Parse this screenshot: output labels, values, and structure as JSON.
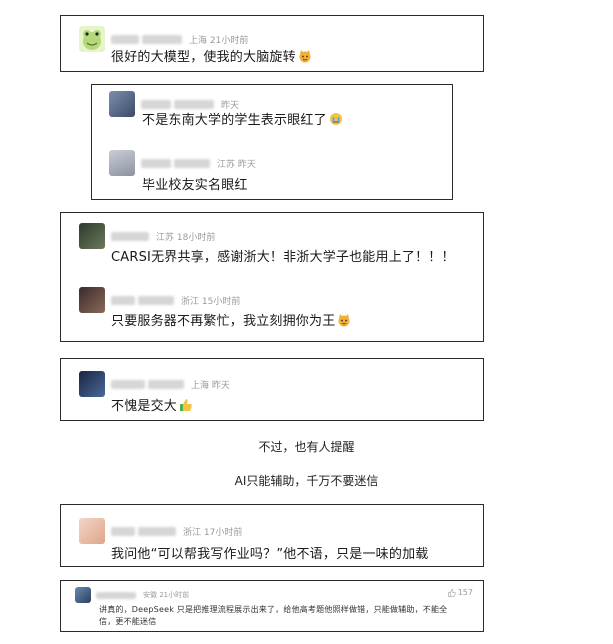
{
  "comments": [
    {
      "meta": "上海 21小时前",
      "text": "很好的大模型，使我的大脑旋转"
    },
    {
      "meta": "昨天",
      "text": "不是东南大学的学生表示眼红了"
    },
    {
      "meta": "江苏 昨天",
      "text": "毕业校友实名眼红"
    },
    {
      "meta": "江苏 18小时前",
      "text": "CARSI无界共享，感谢浙大！非浙大学子也能用上了！！！"
    },
    {
      "meta": "浙江 15小时前",
      "text": "只要服务器不再繁忙，我立刻拥你为王"
    },
    {
      "meta": "上海 昨天",
      "text": "不愧是交大"
    },
    {
      "meta": "浙江 17小时前",
      "text": "我问他“可以帮我写作业吗？”他不语，只是一味的加载"
    },
    {
      "meta": "安徽 21小时前",
      "like": "157",
      "line1": "讲真的，DeepSeek 只是把推理流程展示出来了，给他高考题他照样做错，只能做辅助，不能全",
      "line2": "信，更不能迷信"
    }
  ],
  "captions": {
    "first": "不过，也有人提醒",
    "second": "AI只能辅助，千万不要迷信"
  },
  "colors": {
    "border": "#2b2b2b",
    "meta": "#9a9a9a",
    "text": "#1a1a1a",
    "placeholder": "#d6d6d6"
  },
  "icons": [
    "frog-avatar-icon",
    "cat-emoji-icon",
    "crying-emoji-icon",
    "thumbs-up-icon"
  ]
}
